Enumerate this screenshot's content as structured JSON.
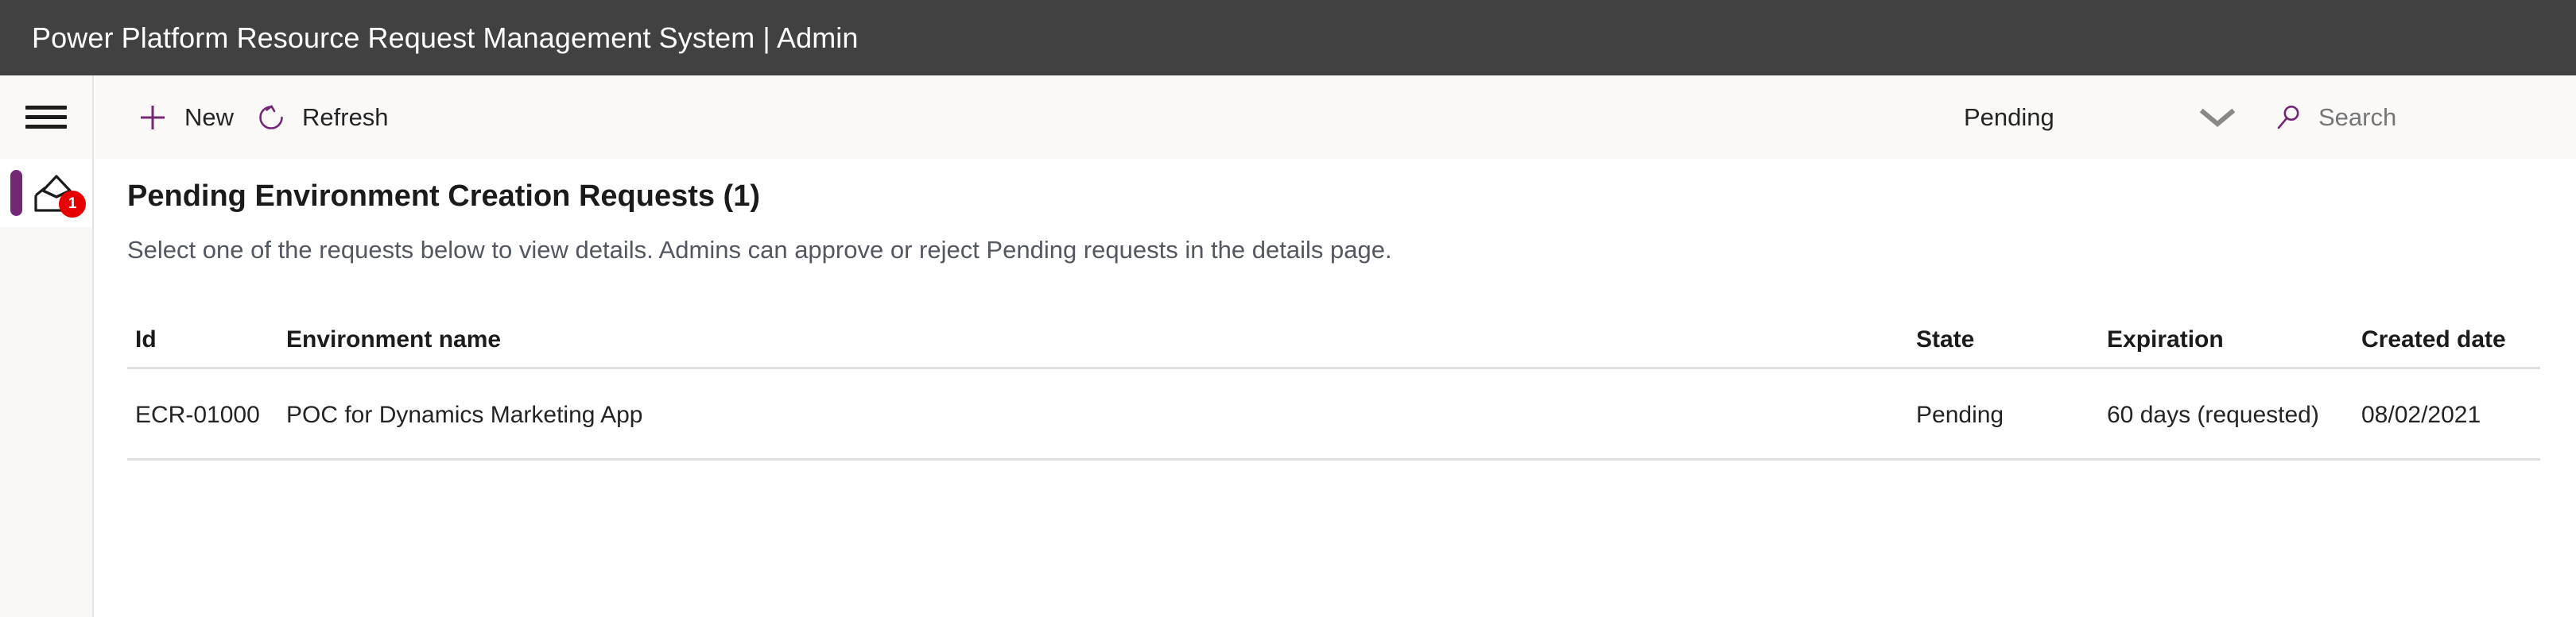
{
  "titlebar": {
    "title": "Power Platform Resource Request Management System | Admin",
    "background": "#414141",
    "text_color": "#ffffff"
  },
  "theme": {
    "accent": "#742774",
    "badge": "#e60000",
    "command_bar_bg": "#faf9f8",
    "divider": "#e1dfdd"
  },
  "rail": {
    "menu_icon": "hamburger-menu-icon",
    "items": [
      {
        "icon": "inbox-tray-icon",
        "badge_count": "1",
        "active": true
      }
    ]
  },
  "commandbar": {
    "new_label": "New",
    "new_icon": "plus-icon",
    "refresh_label": "Refresh",
    "refresh_icon": "refresh-circular-arrow-icon",
    "filter_value": "Pending",
    "filter_chevron_icon": "chevron-down-icon",
    "search_icon": "search-magnifier-icon",
    "search_value": "",
    "search_placeholder": "Search"
  },
  "main": {
    "heading": "Pending Environment Creation Requests (1)",
    "subtitle": "Select one of the requests below to view details. Admins can approve or reject Pending requests in the details page."
  },
  "table": {
    "columns": [
      {
        "key": "id",
        "label": "Id"
      },
      {
        "key": "environment_name",
        "label": "Environment name"
      },
      {
        "key": "state",
        "label": "State"
      },
      {
        "key": "expiration",
        "label": "Expiration"
      },
      {
        "key": "created_date",
        "label": "Created date"
      }
    ],
    "rows": [
      {
        "id": "ECR-01000",
        "environment_name": "POC for Dynamics Marketing App",
        "state": "Pending",
        "expiration": "60 days (requested)",
        "created_date": "08/02/2021"
      }
    ]
  }
}
